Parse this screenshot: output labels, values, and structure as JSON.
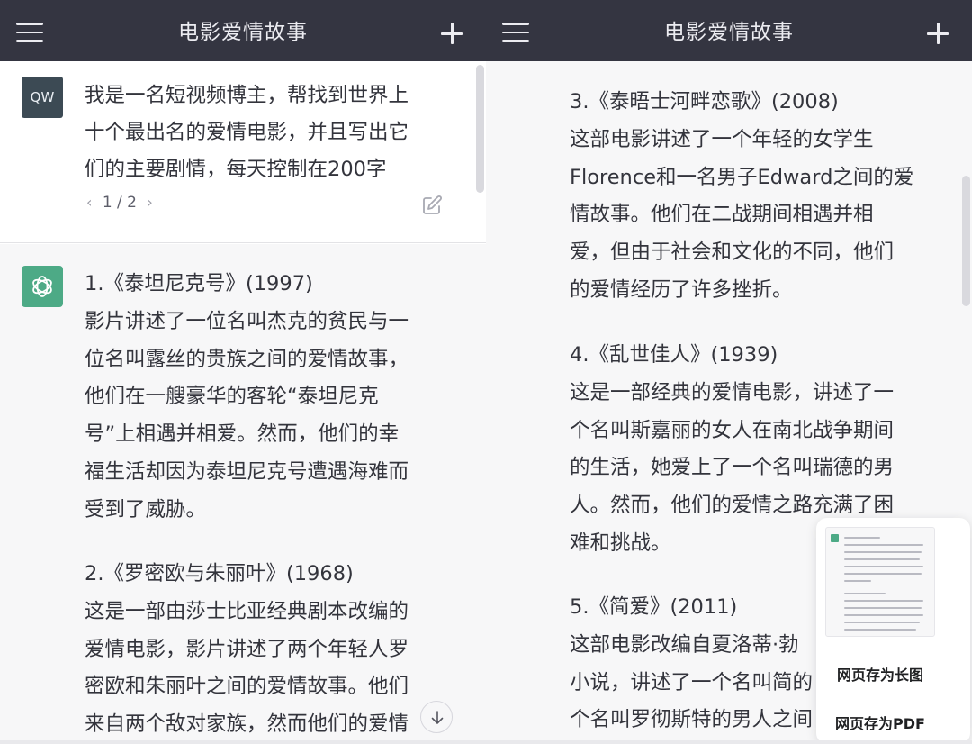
{
  "left": {
    "header": {
      "title": "电影爱情故事"
    },
    "user_message": {
      "avatar_text": "QW",
      "lines": [
        "我是一名短视频博主，帮找到世界上",
        "十个最出名的爱情电影，并且写出它",
        "们的主要剧情，每天控制在200字"
      ],
      "pager": {
        "prev": "‹",
        "current": "1 / 2",
        "next": "›"
      }
    },
    "answers": [
      {
        "head": "1.《泰坦尼克号》(1997)",
        "lines": [
          "影片讲述了一位名叫杰克的贫民与一",
          "位名叫露丝的贵族之间的爱情故事，",
          "他们在一艘豪华的客轮“泰坦尼克",
          "号”上相遇并相爱。然而，他们的幸",
          "福生活却因为泰坦尼克号遭遇海难而",
          "受到了威胁。"
        ]
      },
      {
        "head": "2.《罗密欧与朱丽叶》(1968)",
        "lines": [
          "这是一部由莎士比亚经典剧本改编的",
          "爱情电影，影片讲述了两个年轻人罗",
          "密欧和朱丽叶之间的爱情故事。他们",
          "来自两个敌对家族，然而他们的爱情"
        ]
      }
    ]
  },
  "right": {
    "header": {
      "title": "电影爱情故事"
    },
    "answers": [
      {
        "head": "3.《泰晤士河畔恋歌》(2008)",
        "lines": [
          "这部电影讲述了一个年轻的女学生",
          "Florence和一名男子Edward之间的爱",
          "情故事。他们在二战期间相遇并相",
          "爱，但由于社会和文化的不同，他们",
          "的爱情经历了许多挫折。"
        ]
      },
      {
        "head": "4.《乱世佳人》(1939)",
        "lines": [
          "这是一部经典的爱情电影，讲述了一",
          "个名叫斯嘉丽的女人在南北战争期间",
          "的生活，她爱上了一个名叫瑞德的男",
          "人。然而，他们的爱情之路充满了困",
          "难和挑战。"
        ]
      },
      {
        "head": "5.《简爱》(2011)",
        "lines": [
          "这部电影改编自夏洛蒂·勃",
          "小说，讲述了一个名叫简的",
          "个名叫罗彻斯特的男人之间"
        ]
      }
    ]
  },
  "popup": {
    "option_long_image": "网页存为长图",
    "option_pdf": "网页存为PDF"
  },
  "colors": {
    "header_bg": "#343541",
    "assistant_bg": "#f7f7f8",
    "gpt_avatar": "#4daa86",
    "user_avatar": "#3c4a54"
  },
  "icons": [
    "menu-icon",
    "plus-icon",
    "edit-icon",
    "openai-logo-icon",
    "arrow-down-icon"
  ]
}
